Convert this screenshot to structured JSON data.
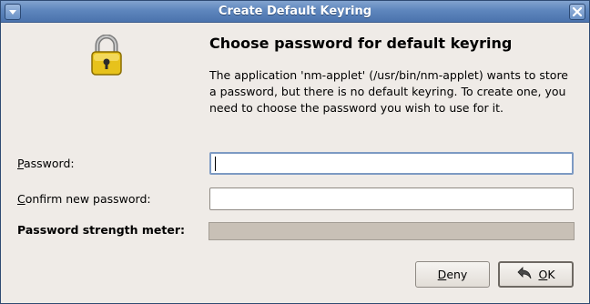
{
  "window": {
    "title": "Create Default Keyring"
  },
  "icons": {
    "window_menu": "window-menu-icon",
    "close": "close-icon",
    "lock": "padlock-icon",
    "ok": "ok-icon"
  },
  "dialog": {
    "heading": "Choose password for default keyring",
    "description": "The application 'nm-applet' (/usr/bin/nm-applet) wants to store a password, but there is no default keyring. To create one, you need to choose the password you wish to use for it."
  },
  "form": {
    "password_label_mnemonic": "P",
    "password_label_rest": "assword:",
    "password_value": "",
    "confirm_label_mnemonic": "C",
    "confirm_label_rest": "onfirm new password:",
    "confirm_value": "",
    "strength_label": "Password strength meter:",
    "strength_fraction": 0
  },
  "buttons": {
    "deny_mnemonic": "D",
    "deny_rest": "eny",
    "ok_mnemonic": "O",
    "ok_rest": "K"
  },
  "colors": {
    "titlebar": "#5e86bd",
    "window_bg": "#efebe7",
    "lock_gold": "#e7c21c"
  }
}
